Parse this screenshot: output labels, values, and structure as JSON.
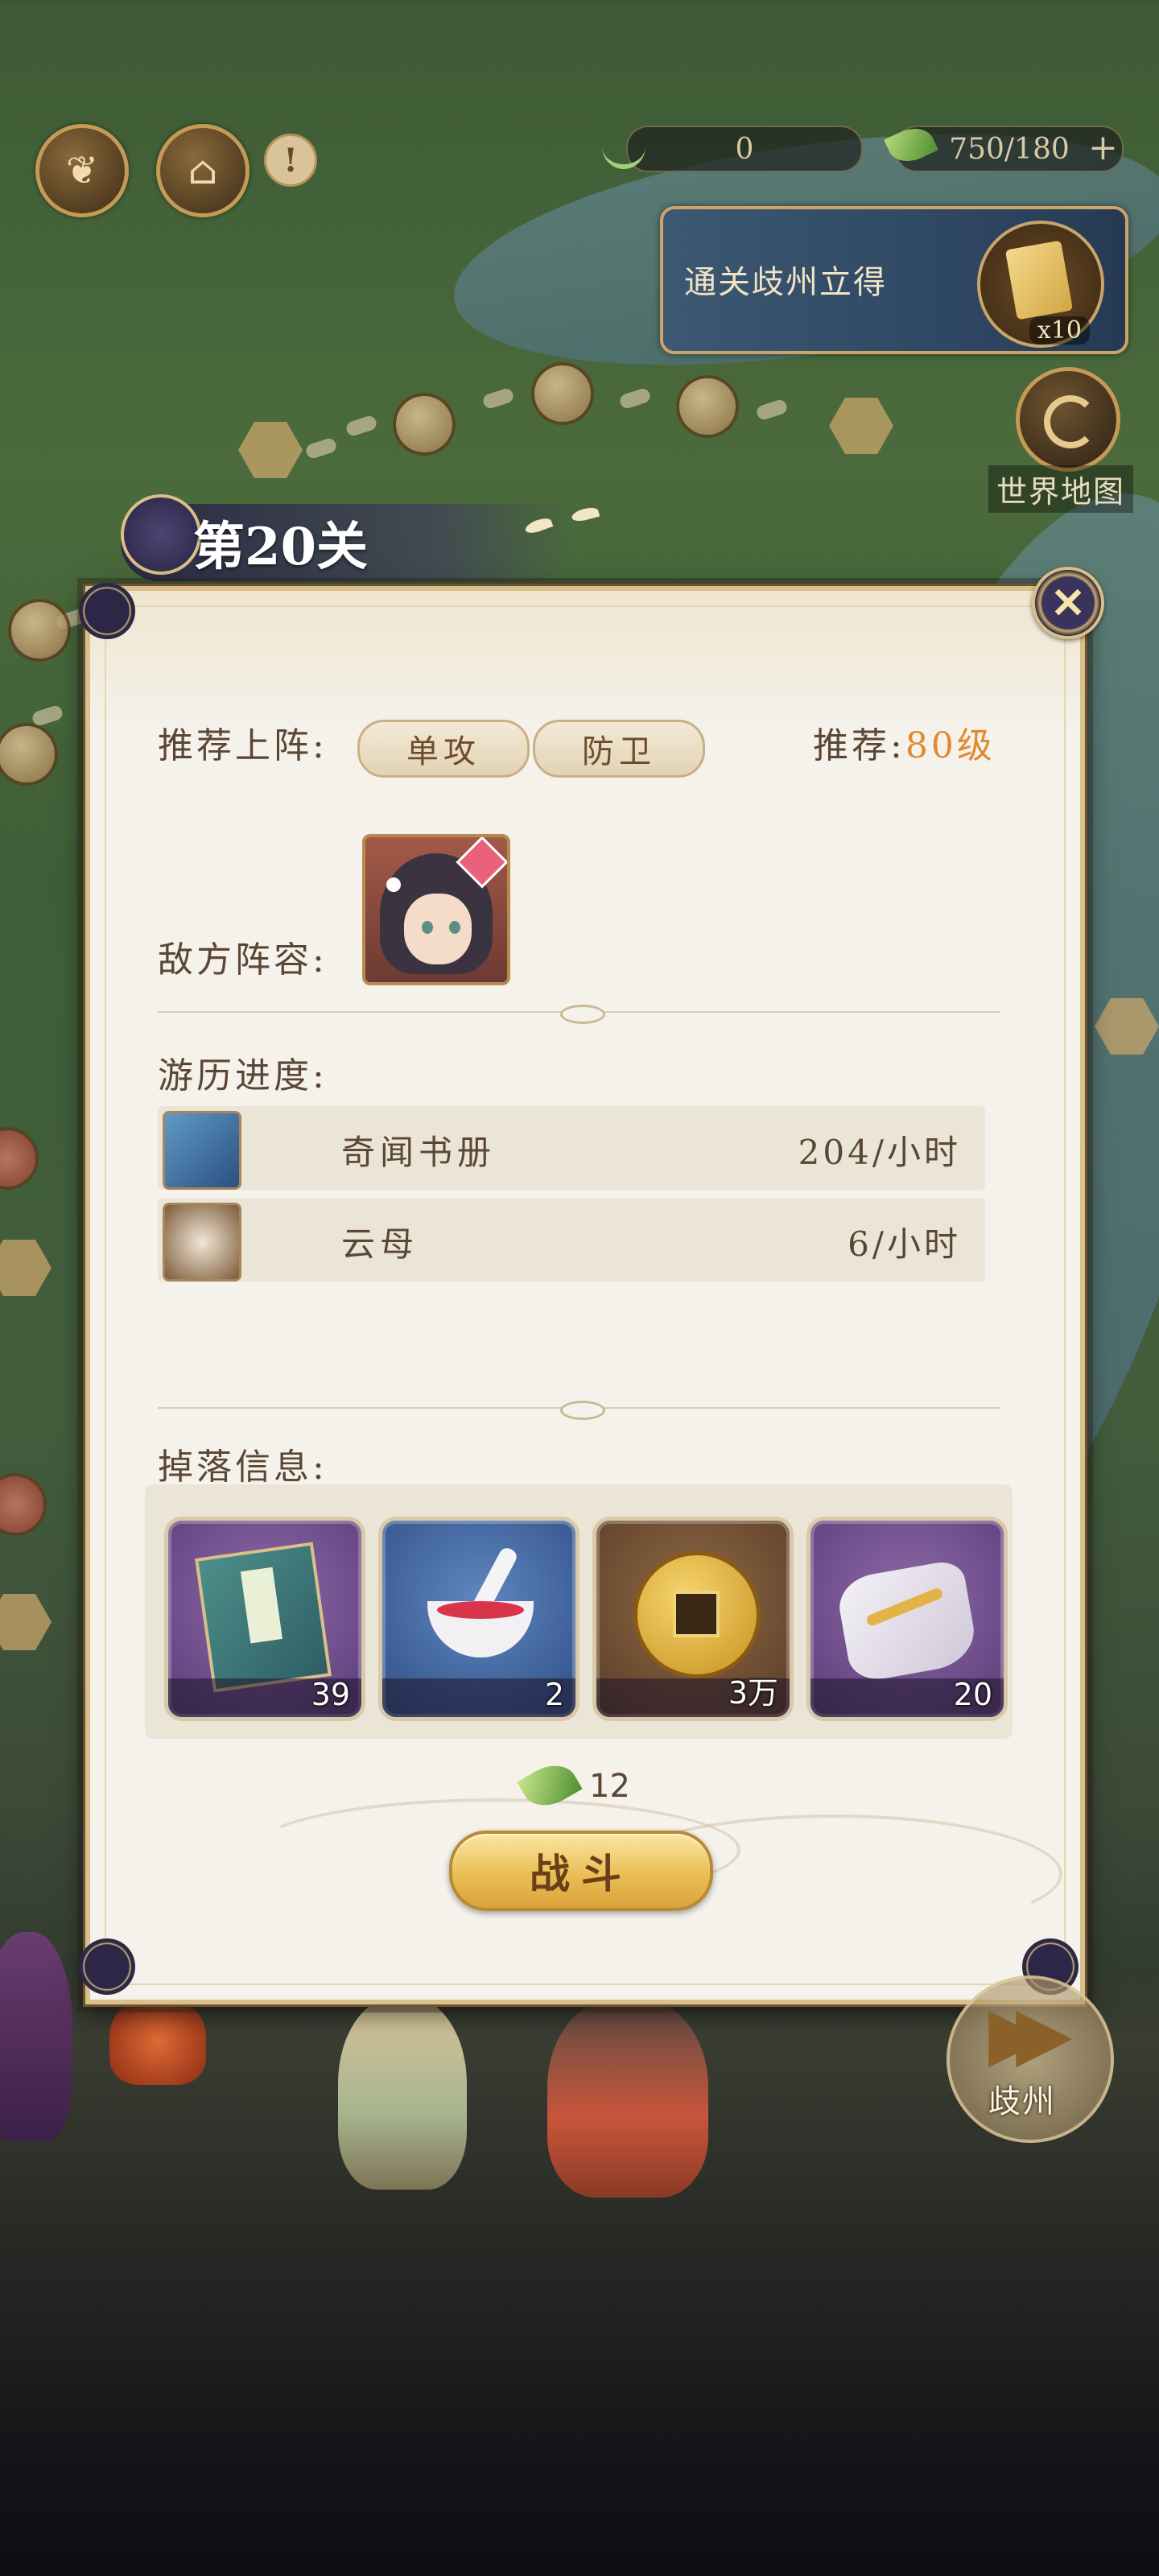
{
  "hud": {
    "resource_one_value": "0",
    "stamina_value": "750/180",
    "plus_label": "+",
    "alert_label": "!"
  },
  "quest": {
    "text": "通关歧州立得",
    "reward_count": "x10"
  },
  "world_map": {
    "label": "世界地图"
  },
  "level": {
    "title": "第20关"
  },
  "panel": {
    "close_label": "✕",
    "recommended_lineup_label": "推荐上阵:",
    "lineup_tags": [
      "单攻",
      "防卫"
    ],
    "recommended_level_label": "推荐:",
    "recommended_level_value": "80级",
    "enemy_lineup_label": "敌方阵容:",
    "progress_label": "游历进度:",
    "progress_items": [
      {
        "name": "奇闻书册",
        "rate": "204/小时",
        "icon": "book-icon"
      },
      {
        "name": "云母",
        "rate": "6/小时",
        "icon": "mica-icon"
      }
    ],
    "drops_label": "掉落信息:",
    "drops": [
      {
        "icon": "book-reward-icon",
        "count": "39"
      },
      {
        "icon": "rouge-bowl-icon",
        "count": "2"
      },
      {
        "icon": "coin-icon",
        "count": "3万"
      },
      {
        "icon": "hairpin-cloth-icon",
        "count": "20"
      }
    ],
    "stamina_cost": "12",
    "fight_label": "战斗"
  },
  "next_area": {
    "label": "歧州"
  },
  "colors": {
    "accent_orange": "#e08b2f",
    "panel_bg": "#f5f2ec",
    "gold_border": "#d9c08c"
  }
}
